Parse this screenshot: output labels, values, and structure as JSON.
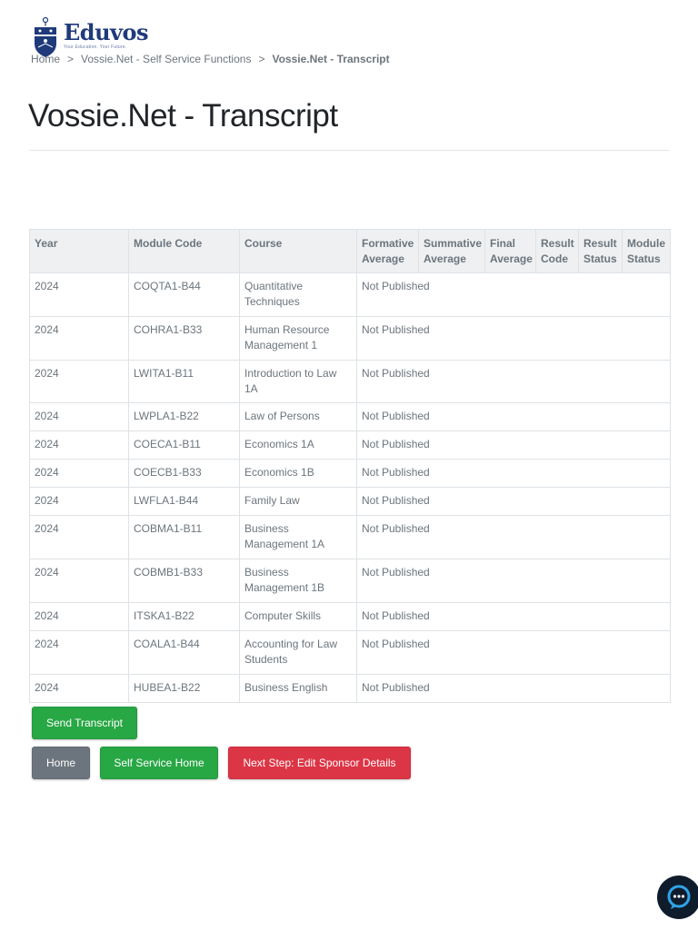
{
  "logo": {
    "name": "Eduvos",
    "tagline": "Your Education. Your Future."
  },
  "breadcrumb": [
    {
      "label": "Home"
    },
    {
      "label": "Vossie.Net - Self Service Functions"
    },
    {
      "label": "Vossie.Net - Transcript"
    }
  ],
  "page_title": "Vossie.Net - Transcript",
  "table": {
    "headers": [
      "Year",
      "Module Code",
      "Course",
      "Formative Average",
      "Summative Average",
      "Final Average",
      "Result Code",
      "Result Status",
      "Module Status"
    ],
    "rows": [
      {
        "year": "2024",
        "code": "COQTA1-B44",
        "course": "Quantitative Techniques",
        "status": "Not Published"
      },
      {
        "year": "2024",
        "code": "COHRA1-B33",
        "course": "Human Resource Management 1",
        "status": "Not Published"
      },
      {
        "year": "2024",
        "code": "LWITA1-B11",
        "course": "Introduction to Law 1A",
        "status": "Not Published"
      },
      {
        "year": "2024",
        "code": "LWPLA1-B22",
        "course": "Law of Persons",
        "status": "Not Published"
      },
      {
        "year": "2024",
        "code": "COECA1-B11",
        "course": "Economics 1A",
        "status": "Not Published"
      },
      {
        "year": "2024",
        "code": "COECB1-B33",
        "course": "Economics 1B",
        "status": "Not Published"
      },
      {
        "year": "2024",
        "code": "LWFLA1-B44",
        "course": "Family Law",
        "status": "Not Published"
      },
      {
        "year": "2024",
        "code": "COBMA1-B11",
        "course": "Business Management 1A",
        "status": "Not Published"
      },
      {
        "year": "2024",
        "code": "COBMB1-B33",
        "course": "Business Management 1B",
        "status": "Not Published"
      },
      {
        "year": "2024",
        "code": "ITSKA1-B22",
        "course": "Computer Skills",
        "status": "Not Published"
      },
      {
        "year": "2024",
        "code": "COALA1-B44",
        "course": "Accounting for Law Students",
        "status": "Not Published"
      },
      {
        "year": "2024",
        "code": "HUBEA1-B22",
        "course": "Business English",
        "status": "Not Published"
      }
    ]
  },
  "buttons": {
    "send_transcript": "Send Transcript",
    "home": "Home",
    "self_service_home": "Self Service Home",
    "next_step": "Next Step: Edit Sponsor Details"
  },
  "colors": {
    "green": "#28a745",
    "gray": "#6c757d",
    "red": "#dc3545",
    "brand": "#1f3a7a"
  },
  "icons": {
    "chat": "chat-bubble-icon",
    "logo": "shield-crest-icon"
  }
}
